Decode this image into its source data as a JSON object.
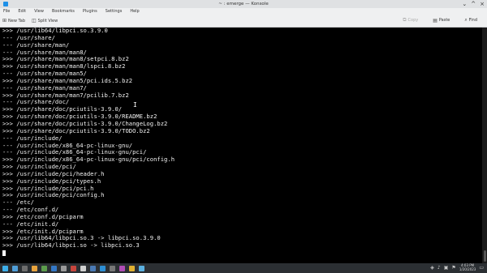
{
  "window": {
    "title": "~ : emerge — Konsole",
    "controls": [
      "⌄",
      "^",
      "×"
    ]
  },
  "menu": [
    "File",
    "Edit",
    "View",
    "Bookmarks",
    "Plugins",
    "Settings",
    "Help"
  ],
  "toolbar": {
    "new_tab": "New Tab",
    "split_view": "Split View",
    "copy": "Copy",
    "paste": "Paste",
    "find": "Find"
  },
  "terminal": {
    "lines": [
      ">>> /usr/lib64/libpci.so.3.9.0",
      "--- /usr/share/",
      "--- /usr/share/man/",
      "--- /usr/share/man/man8/",
      ">>> /usr/share/man/man8/setpci.8.bz2",
      ">>> /usr/share/man/man8/lspci.8.bz2",
      "--- /usr/share/man/man5/",
      ">>> /usr/share/man/man5/pci.ids.5.bz2",
      "--- /usr/share/man/man7/",
      ">>> /usr/share/man/man7/pcilib.7.bz2",
      "--- /usr/share/doc/",
      ">>> /usr/share/doc/pciutils-3.9.0/",
      ">>> /usr/share/doc/pciutils-3.9.0/README.bz2",
      ">>> /usr/share/doc/pciutils-3.9.0/ChangeLog.bz2",
      ">>> /usr/share/doc/pciutils-3.9.0/TODO.bz2",
      "--- /usr/include/",
      "--- /usr/include/x86_64-pc-linux-gnu/",
      "--- /usr/include/x86_64-pc-linux-gnu/pci/",
      ">>> /usr/include/x86_64-pc-linux-gnu/pci/config.h",
      ">>> /usr/include/pci/",
      ">>> /usr/include/pci/header.h",
      ">>> /usr/include/pci/types.h",
      ">>> /usr/include/pci/pci.h",
      ">>> /usr/include/pci/config.h",
      "--- /etc/",
      "--- /etc/conf.d/",
      ">>> /etc/conf.d/pciparm",
      "--- /etc/init.d/",
      ">>> /etc/init.d/pciparm",
      ">>> /usr/lib64/libpci.so.3 -> libpci.so.3.9.0",
      ">>> /usr/lib64/libpci.so -> libpci.so.3"
    ]
  },
  "taskbar": {
    "apps": [
      {
        "name": "app-launcher",
        "color": "#3daee9"
      },
      {
        "name": "task-1",
        "color": "#4f9ed8"
      },
      {
        "name": "task-2",
        "color": "#6d6d6d"
      },
      {
        "name": "task-3",
        "color": "#e8a33d"
      },
      {
        "name": "task-4",
        "color": "#5c9c4c"
      },
      {
        "name": "task-5",
        "color": "#3478c6"
      },
      {
        "name": "task-6",
        "color": "#9a9a9a"
      },
      {
        "name": "task-7",
        "color": "#c8463d"
      },
      {
        "name": "task-8",
        "color": "#d0d0d0"
      },
      {
        "name": "task-9",
        "color": "#4a7ab5"
      },
      {
        "name": "task-10",
        "color": "#2d8fd5"
      },
      {
        "name": "task-11",
        "color": "#777777"
      },
      {
        "name": "task-12",
        "color": "#b04cb5"
      },
      {
        "name": "task-13",
        "color": "#e0b030"
      },
      {
        "name": "task-14",
        "color": "#5bb0e0"
      }
    ],
    "clock_time": "4:03 PM",
    "clock_date": "1/20/2023"
  },
  "colors": {
    "terminal_bg": "#000000",
    "terminal_fg": "#f2f2f2",
    "chrome_bg": "#eff0f1",
    "taskbar_bg": "#2b2f33"
  }
}
